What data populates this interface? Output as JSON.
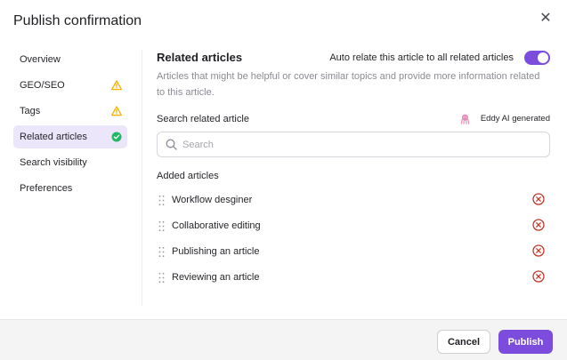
{
  "dialog": {
    "title": "Publish confirmation",
    "close_icon": "close-icon"
  },
  "sidebar": {
    "items": [
      {
        "label": "Overview",
        "status": "none"
      },
      {
        "label": "GEO/SEO",
        "status": "warning"
      },
      {
        "label": "Tags",
        "status": "warning"
      },
      {
        "label": "Related articles",
        "status": "success",
        "active": true
      },
      {
        "label": "Search visibility",
        "status": "none"
      },
      {
        "label": "Preferences",
        "status": "none"
      }
    ]
  },
  "main": {
    "section_title": "Related articles",
    "auto_relate_label": "Auto relate this article to all related articles",
    "auto_relate_enabled": true,
    "description": "Articles that might be helpful or cover similar topics and provide more information related to this article.",
    "search_label": "Search related article",
    "ai_badge": "Eddy AI generated",
    "search_placeholder": "Search",
    "search_value": "",
    "added_title": "Added articles",
    "articles": [
      {
        "name": "Workflow desginer"
      },
      {
        "name": "Collaborative editing"
      },
      {
        "name": "Publishing an article"
      },
      {
        "name": "Reviewing an article"
      }
    ]
  },
  "footer": {
    "cancel_label": "Cancel",
    "publish_label": "Publish"
  },
  "colors": {
    "accent": "#7c4ddc",
    "active_bg": "#ece6fb",
    "warning": "#f0b400",
    "success": "#22b864",
    "remove": "#c0392b",
    "ai_icon": "#e58fb8"
  }
}
